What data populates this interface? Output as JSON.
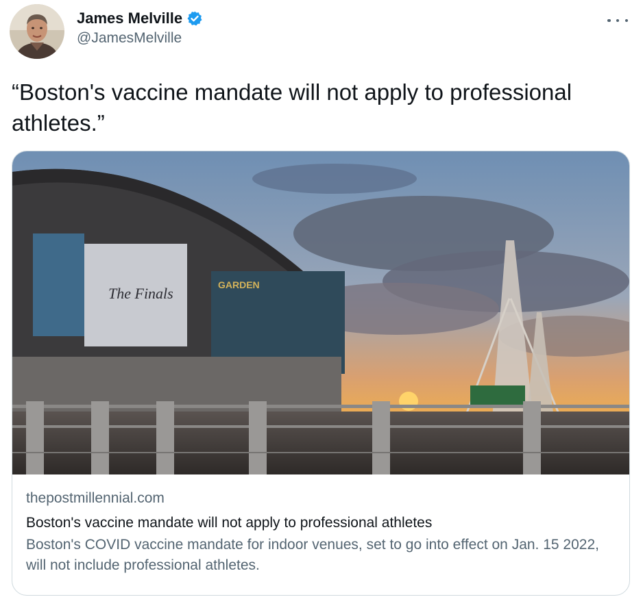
{
  "author": {
    "display_name": "James Melville",
    "handle": "@JamesMelville",
    "verified_icon": "verified-badge-icon",
    "avatar_icon": "profile-photo"
  },
  "actions": {
    "more_icon": "more-options-icon"
  },
  "tweet": {
    "text": "“Boston's vaccine mandate will not apply to professional athletes.”"
  },
  "card": {
    "image_sign": "GARDEN",
    "image_banner": "The Finals",
    "domain": "thepostmillennial.com",
    "title": "Boston's vaccine mandate will not apply to professional athletes",
    "description": "Boston's COVID vaccine mandate for indoor venues, set to go into effect on Jan. 15 2022, will not include professional athletes."
  },
  "colors": {
    "verified": "#1d9bf0",
    "secondary_text": "#536471",
    "border": "#cfd9de"
  }
}
